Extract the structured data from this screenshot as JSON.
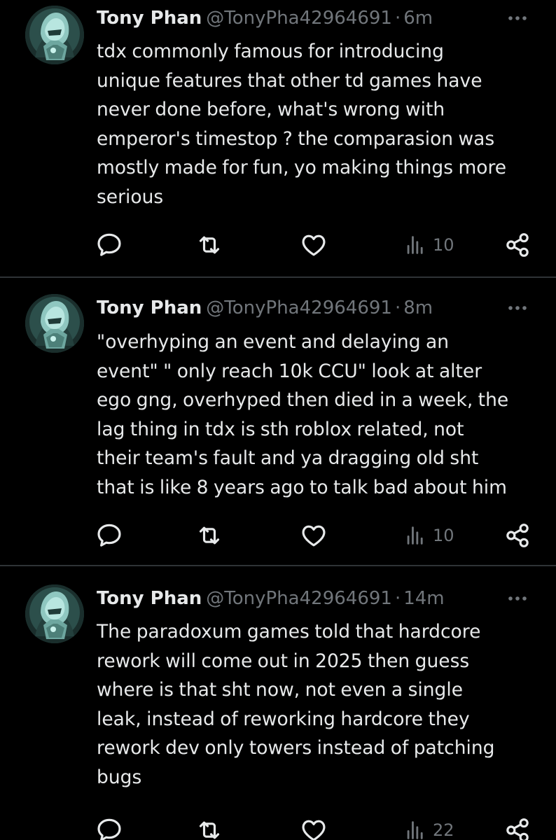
{
  "tweets": [
    {
      "author_name": "Tony Phan",
      "handle": "@TonyPha42964691",
      "separator": "·",
      "time": "6m",
      "text": "tdx commonly famous for introducing\nunique features that other td games have\nnever done before, what's wrong with\nemperor's timestop ? the comparasion was\nmostly made for fun, yo making things more\nserious",
      "views": "10"
    },
    {
      "author_name": "Tony Phan",
      "handle": "@TonyPha42964691",
      "separator": "·",
      "time": "8m",
      "text": "\"overhyping an event and delaying an\nevent\" \" only reach 10k CCU\" look at alter\nego gng, overhyped then died in a week, the\nlag thing in tdx is sth roblox related, not\ntheir team's fault and ya dragging old sht\nthat is like 8 years ago to talk bad about him",
      "views": "10"
    },
    {
      "author_name": "Tony Phan",
      "handle": "@TonyPha42964691",
      "separator": "·",
      "time": "14m",
      "text": "The paradoxum games told that hardcore\nrework will come out in 2025 then guess\nwhere is that sht now, not even a single\nleak, instead of reworking hardcore they\nrework dev only towers instead of patching\nbugs",
      "views": "22"
    }
  ],
  "icons": {
    "reply": "reply-icon",
    "retweet": "retweet-icon",
    "like": "heart-icon",
    "views": "views-icon",
    "share": "share-icon",
    "more": "more-icon",
    "avatar": "avatar"
  },
  "colors": {
    "background": "#000000",
    "text": "#e7e9ea",
    "secondary": "#71767b",
    "divider": "#2f3336"
  }
}
